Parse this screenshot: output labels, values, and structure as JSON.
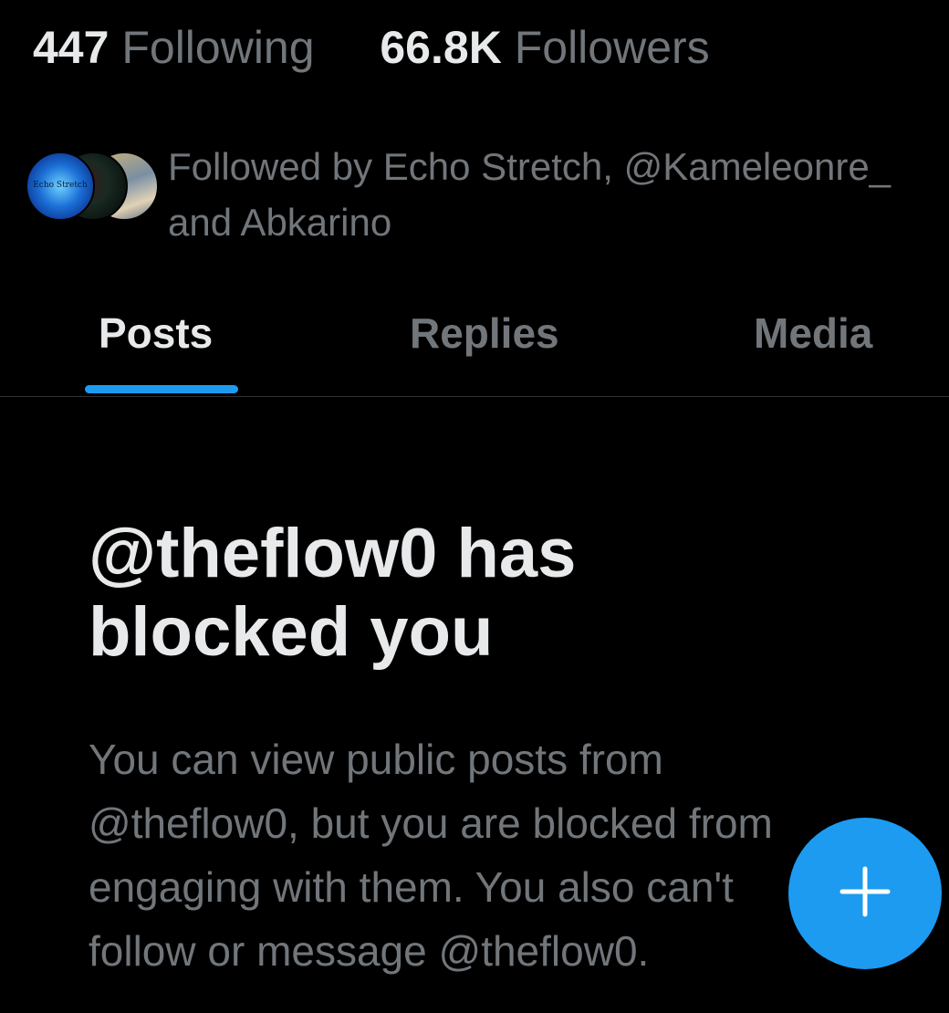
{
  "stats": {
    "following_count": "447",
    "following_label": "Following",
    "followers_count": "66.8K",
    "followers_label": "Followers"
  },
  "followed_by": {
    "line1": "Followed by Echo Stretch, @Kameleonre_",
    "line2": "and Abkarino",
    "avatars": [
      {
        "name": "Echo Stretch",
        "label": "Echo Stretch"
      },
      {
        "name": "@Kameleonre_"
      },
      {
        "name": "Abkarino"
      }
    ]
  },
  "tabs": [
    {
      "label": "Posts",
      "active": true
    },
    {
      "label": "Replies",
      "active": false
    },
    {
      "label": "Media",
      "active": false
    }
  ],
  "blocked": {
    "title_line1": "@theflow0 has",
    "title_line2": "blocked you",
    "body_line1": "You can view public posts from",
    "body_line2": "@theflow0, but you are blocked from",
    "body_line3": "engaging with them. You also can't",
    "body_line4": "follow or message @theflow0."
  },
  "fab": {
    "icon": "plus-icon"
  },
  "colors": {
    "background": "#000000",
    "primary_text": "#e7e9ea",
    "secondary_text": "#71767b",
    "accent": "#1d9bf0",
    "divider": "#2f3336"
  }
}
